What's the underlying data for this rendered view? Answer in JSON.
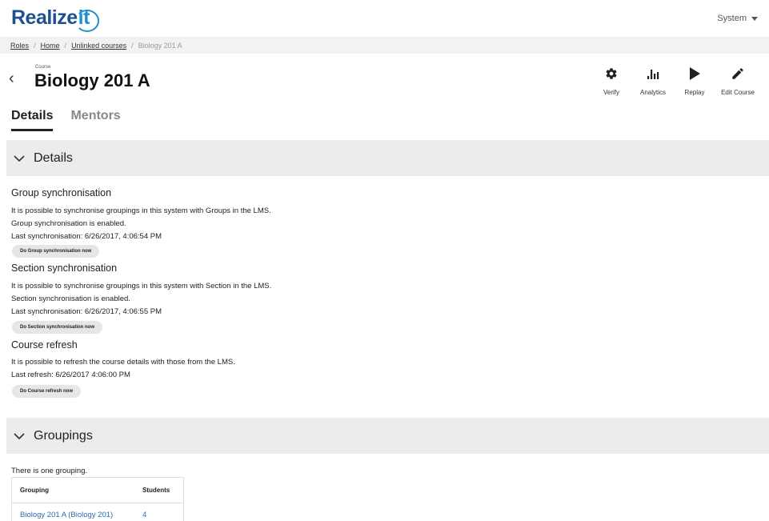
{
  "header": {
    "logo_main": "Realize",
    "logo_accent": "it",
    "user_menu_label": "System"
  },
  "breadcrumb": {
    "items": [
      "Roles",
      "Home",
      "Unlinked courses"
    ],
    "current": "Biology 201 A"
  },
  "course": {
    "eyebrow": "Course",
    "title": "Biology 201 A"
  },
  "actions": [
    {
      "label": "Verify",
      "icon": "gear-icon"
    },
    {
      "label": "Analytics",
      "icon": "bar-chart-icon"
    },
    {
      "label": "Replay",
      "icon": "play-icon"
    },
    {
      "label": "Edit Course",
      "icon": "pencil-icon"
    }
  ],
  "tabs": [
    {
      "label": "Details",
      "active": true
    },
    {
      "label": "Mentors",
      "active": false
    }
  ],
  "details_section": {
    "label": "Details",
    "group_sync": {
      "heading": "Group synchronisation",
      "line1": "It is possible to synchronise groupings in this system with Groups in the LMS.",
      "line2": "Group synchronisation is enabled.",
      "line3": "Last synchronisation: 6/26/2017, 4:06:54 PM",
      "button": "Do Group synchronisation now"
    },
    "section_sync": {
      "heading": "Section synchronisation",
      "line1": "It is possible to synchronise groupings in this system with Section in the LMS.",
      "line2": "Section synchronisation is enabled.",
      "line3": "Last synchronisation: 6/26/2017, 4:06:55 PM",
      "button": "Do Section synchronisation now"
    },
    "course_refresh": {
      "heading": "Course refresh",
      "line1": "It is possible to refresh the course details with those from the LMS.",
      "line2": "Last refresh: 6/26/2017 4:06:00 PM",
      "button": "Do Course refresh now"
    }
  },
  "groupings_section": {
    "label": "Groupings",
    "intro": "There is one grouping.",
    "columns": [
      "Grouping",
      "Students"
    ],
    "rows": [
      {
        "grouping": "Biology 201 A (Biology 201)",
        "students": "4"
      }
    ]
  },
  "colors": {
    "brand_dark": "#1f4f8c",
    "brand_light": "#1e8fcf",
    "link": "#2b6cb0",
    "section_bg": "#ececec"
  }
}
